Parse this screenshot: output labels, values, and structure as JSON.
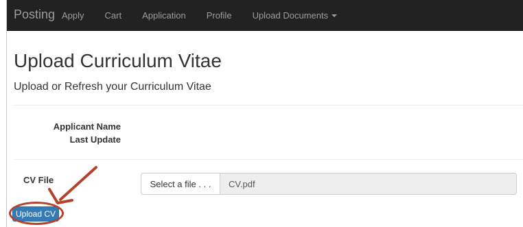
{
  "navbar": {
    "brand": "Posting",
    "items": [
      {
        "label": "Apply"
      },
      {
        "label": "Cart"
      },
      {
        "label": "Application"
      },
      {
        "label": "Profile"
      },
      {
        "label": "Upload Documents",
        "dropdown": true
      }
    ]
  },
  "page": {
    "title": "Upload Curriculum Vitae",
    "subtitle": "Upload or Refresh your Curriculum Vitae"
  },
  "details": {
    "applicant_name_label": "Applicant Name",
    "last_update_label": "Last Update"
  },
  "upload": {
    "cv_label": "CV File",
    "select_button_label": "Select a file . . .",
    "file_name": "CV.pdf",
    "upload_button_label": "Upload CV"
  },
  "colors": {
    "navbar_bg": "#222222",
    "primary_button": "#337ab7",
    "annotation": "#b5432c"
  },
  "icons": {
    "dropdown": "caret-down-icon",
    "annotation_arrow": "arrow-annotation",
    "annotation_circle": "circle-annotation"
  }
}
